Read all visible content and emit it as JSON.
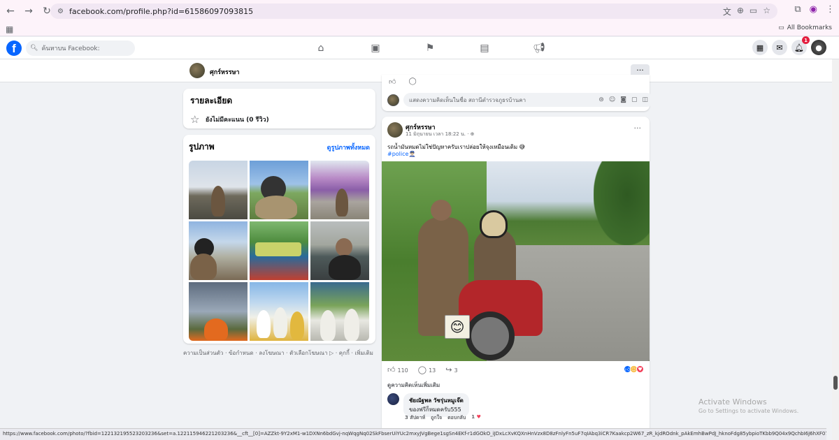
{
  "browser": {
    "url": "facebook.com/profile.php?id=61586097093815",
    "all_bookmarks": "All Bookmarks"
  },
  "fb": {
    "logo": "f",
    "search_placeholder": "ค้นหาบน Facebook:",
    "notification_count": "1"
  },
  "profile": {
    "name": "ศุกร์หรรษา",
    "more": "···"
  },
  "details": {
    "title": "รายละเอียด",
    "rating_text": "ยังไม่มีคะแนน (0 รีวิว)"
  },
  "photos": {
    "title": "รูปภาพ",
    "see_all": "ดูรูปภาพทั้งหมด"
  },
  "footer_links": "ความเป็นส่วนตัว · ข้อกำหนด · ลงโฆษณา · ตัวเลือกโฆษณา ▷ · คุกกี้ · เพิ่มเติม",
  "prev_post": {
    "comment_placeholder": "แสดงความคิดเห็นในชื่อ สถานีตำรวจภูธรบ้านคา"
  },
  "post": {
    "author": "ศุกร์หรรษา",
    "time": "11 มิถุนายน เวลา 18:22 น. · ⊕",
    "more": "···",
    "text": "รถน้ำมันหมดไม่ใช่ปัญหาครับเราปล่อยให้จุงเหมือนเดิม 😅",
    "hashtag": "#police👮🏻‍♂️",
    "likes": "110",
    "comments": "13",
    "shares": "3",
    "view_more_comments": "ดูความคิดเห็นเพิ่มเติม",
    "comment": {
      "name": "ชัยณัฐพล วัชรุ่นหมูเจ๊ด",
      "text": "ของฟรีก็หมดครับ555",
      "time": "3 สัปดาห์",
      "like": "ถูกใจ",
      "reply": "ตอบกลับ",
      "reaction_count": "1"
    }
  },
  "windows": {
    "title": "Activate Windows",
    "subtitle": "Go to Settings to activate Windows."
  },
  "status_url": "https://www.facebook.com/photo/?fbid=122132195523203236&set=a.122115946221203236&__cft__[0]=AZZkt-9Y2xM1-w1DXNn6bdGvj-nqWqgNq02SkFbserUiYUc2mxyJVgBege1sgSn4EKf-r1dGOkO_iJDxLcXvKQXnHnVzx8D8zFnlyFn5uF7qIAbq3iCR7Kaakcp2W67_zR_kjdROdnk_pAkEmhBwPdJ_hknoFdg85ybpioTKbb9Q04x9QchbI6J6hXF07BmEcsuexXhnfb..."
}
